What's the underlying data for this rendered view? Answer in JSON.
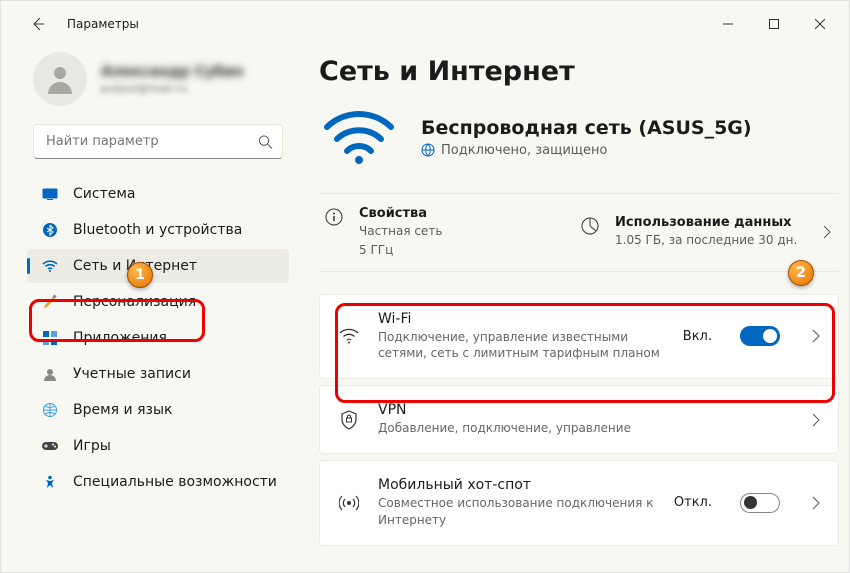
{
  "window": {
    "title": "Параметры"
  },
  "profile": {
    "name": "Александр Субин",
    "email": "putput@mail.ru"
  },
  "search": {
    "placeholder": "Найти параметр"
  },
  "sidebar": {
    "items": [
      {
        "label": "Система"
      },
      {
        "label": "Bluetooth и устройства"
      },
      {
        "label": "Сеть и Интернет"
      },
      {
        "label": "Персонализация"
      },
      {
        "label": "Приложения"
      },
      {
        "label": "Учетные записи"
      },
      {
        "label": "Время и язык"
      },
      {
        "label": "Игры"
      },
      {
        "label": "Специальные возможности"
      }
    ]
  },
  "page": {
    "title": "Сеть и Интернет",
    "hero": {
      "title": "Беспроводная сеть (ASUS_5G)",
      "status": "Подключено, защищено"
    },
    "props": {
      "title": "Свойства",
      "sub1": "Частная сеть",
      "sub2": "5 ГГц"
    },
    "usage": {
      "title": "Использование данных",
      "sub": "1.05 ГБ, за последние 30 дн."
    },
    "cards": [
      {
        "title": "Wi-Fi",
        "sub": "Подключение, управление известными сетями, сеть с лимитным тарифным планом",
        "state": "Вкл.",
        "toggle": "on"
      },
      {
        "title": "VPN",
        "sub": "Добавление, подключение, управление"
      },
      {
        "title": "Мобильный хот-спот",
        "sub": "Совместное использование подключения к Интернету",
        "state": "Откл.",
        "toggle": "off"
      }
    ]
  },
  "annotations": {
    "badge1": "1",
    "badge2": "2"
  }
}
